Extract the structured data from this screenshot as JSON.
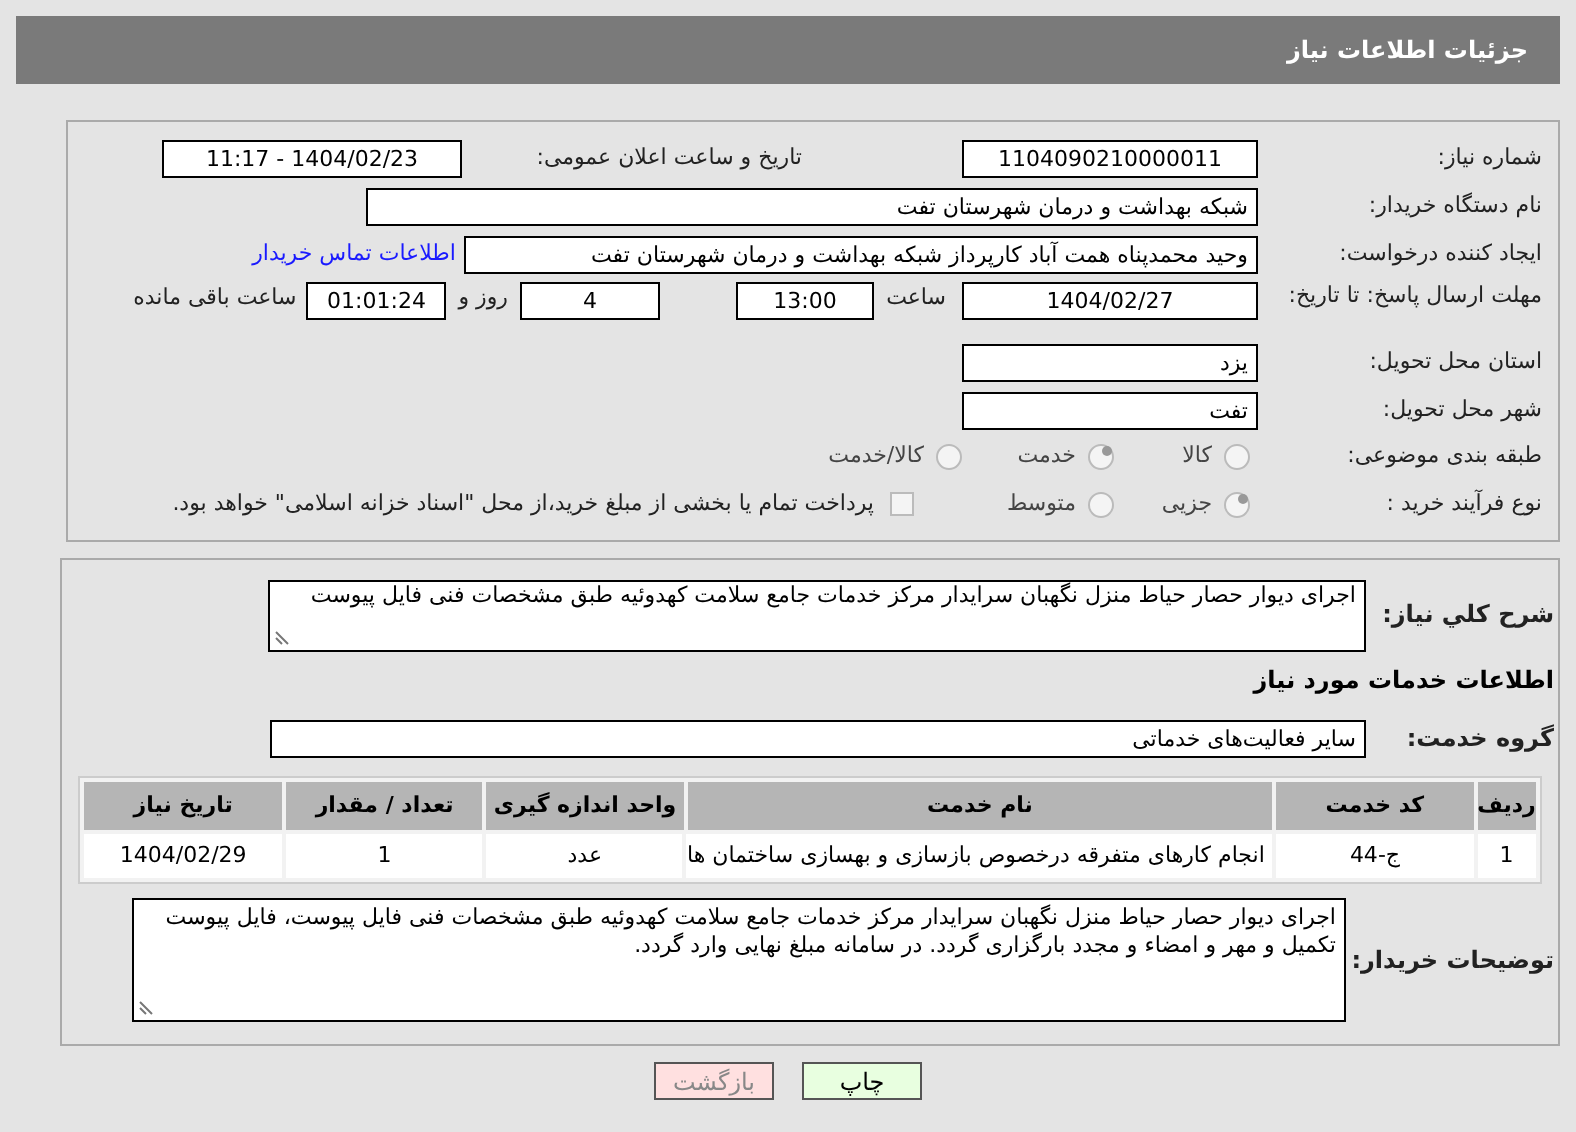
{
  "header": {
    "title": "جزئیات اطلاعات نیاز"
  },
  "need_number": {
    "label": "شماره نیاز:",
    "value": "1104090210000011"
  },
  "announce": {
    "label": "تاریخ و ساعت اعلان عمومی:",
    "value": "1404/02/23 - 11:17"
  },
  "buyer_org": {
    "label": "نام دستگاه خریدار:",
    "value": "شبکه بهداشت و درمان شهرستان تفت"
  },
  "creator": {
    "label": "ایجاد کننده درخواست:",
    "value": "وحید محمدپناه همت آباد کارپرداز شبکه بهداشت و درمان شهرستان تفت",
    "link": "اطلاعات تماس خریدار"
  },
  "deadline": {
    "label": "مهلت ارسال پاسخ: تا تاریخ:",
    "date": "1404/02/27",
    "time_label": "ساعت",
    "time": "13:00",
    "days": "4",
    "days_label": "روز و",
    "remaining": "01:01:24",
    "remaining_label": "ساعت باقی مانده"
  },
  "province": {
    "label": "استان محل تحویل:",
    "value": "یزد"
  },
  "city": {
    "label": "شهر محل تحویل:",
    "value": "تفت"
  },
  "category": {
    "label": "طبقه بندی موضوعی:",
    "options": [
      {
        "label": "کالا",
        "selected": false
      },
      {
        "label": "خدمت",
        "selected": true
      },
      {
        "label": "کالا/خدمت",
        "selected": false
      }
    ]
  },
  "process": {
    "label": "نوع فرآیند خرید :",
    "options": [
      {
        "label": "جزیی",
        "selected": true
      },
      {
        "label": "متوسط",
        "selected": false
      }
    ],
    "checkbox": {
      "label": "پرداخت تمام یا بخشی از مبلغ خرید،از محل \"اسناد خزانه اسلامی\" خواهد بود.",
      "checked": false
    }
  },
  "description": {
    "label": "شرح کلي نياز:",
    "value": "اجرای دیوار حصار حیاط منزل نگهبان سرایدار مرکز خدمات جامع سلامت  کهدوئیه طبق مشخصات فنی فایل پیوست"
  },
  "services_heading": "اطلاعات خدمات مورد نیاز",
  "service_group": {
    "label": "گروه خدمت:",
    "value": "سایر فعالیت‌های خدماتی"
  },
  "table": {
    "columns": [
      "ردیف",
      "کد خدمت",
      "نام خدمت",
      "واحد اندازه گیری",
      "تعداد / مقدار",
      "تاریخ نیاز"
    ],
    "rows": [
      [
        "1",
        "ج-44",
        "انجام کارهای متفرقه درخصوص بازسازی و بهسازی ساختمان ها",
        "عدد",
        "1",
        "1404/02/29"
      ]
    ]
  },
  "buyer_notes": {
    "label": "توضیحات خریدار:",
    "value": "اجرای دیوار حصار حیاط منزل نگهبان سرایدار مرکز خدمات جامع سلامت  کهدوئیه طبق مشخصات فنی فایل پیوست، فایل پیوست تکمیل و مهر و امضاء و مجدد بارگزاری گردد. در سامانه مبلغ نهایی وارد گردد."
  },
  "buttons": [
    {
      "label": "چاپ",
      "kind": "print"
    },
    {
      "label": "بازگشت",
      "kind": "back"
    }
  ]
}
